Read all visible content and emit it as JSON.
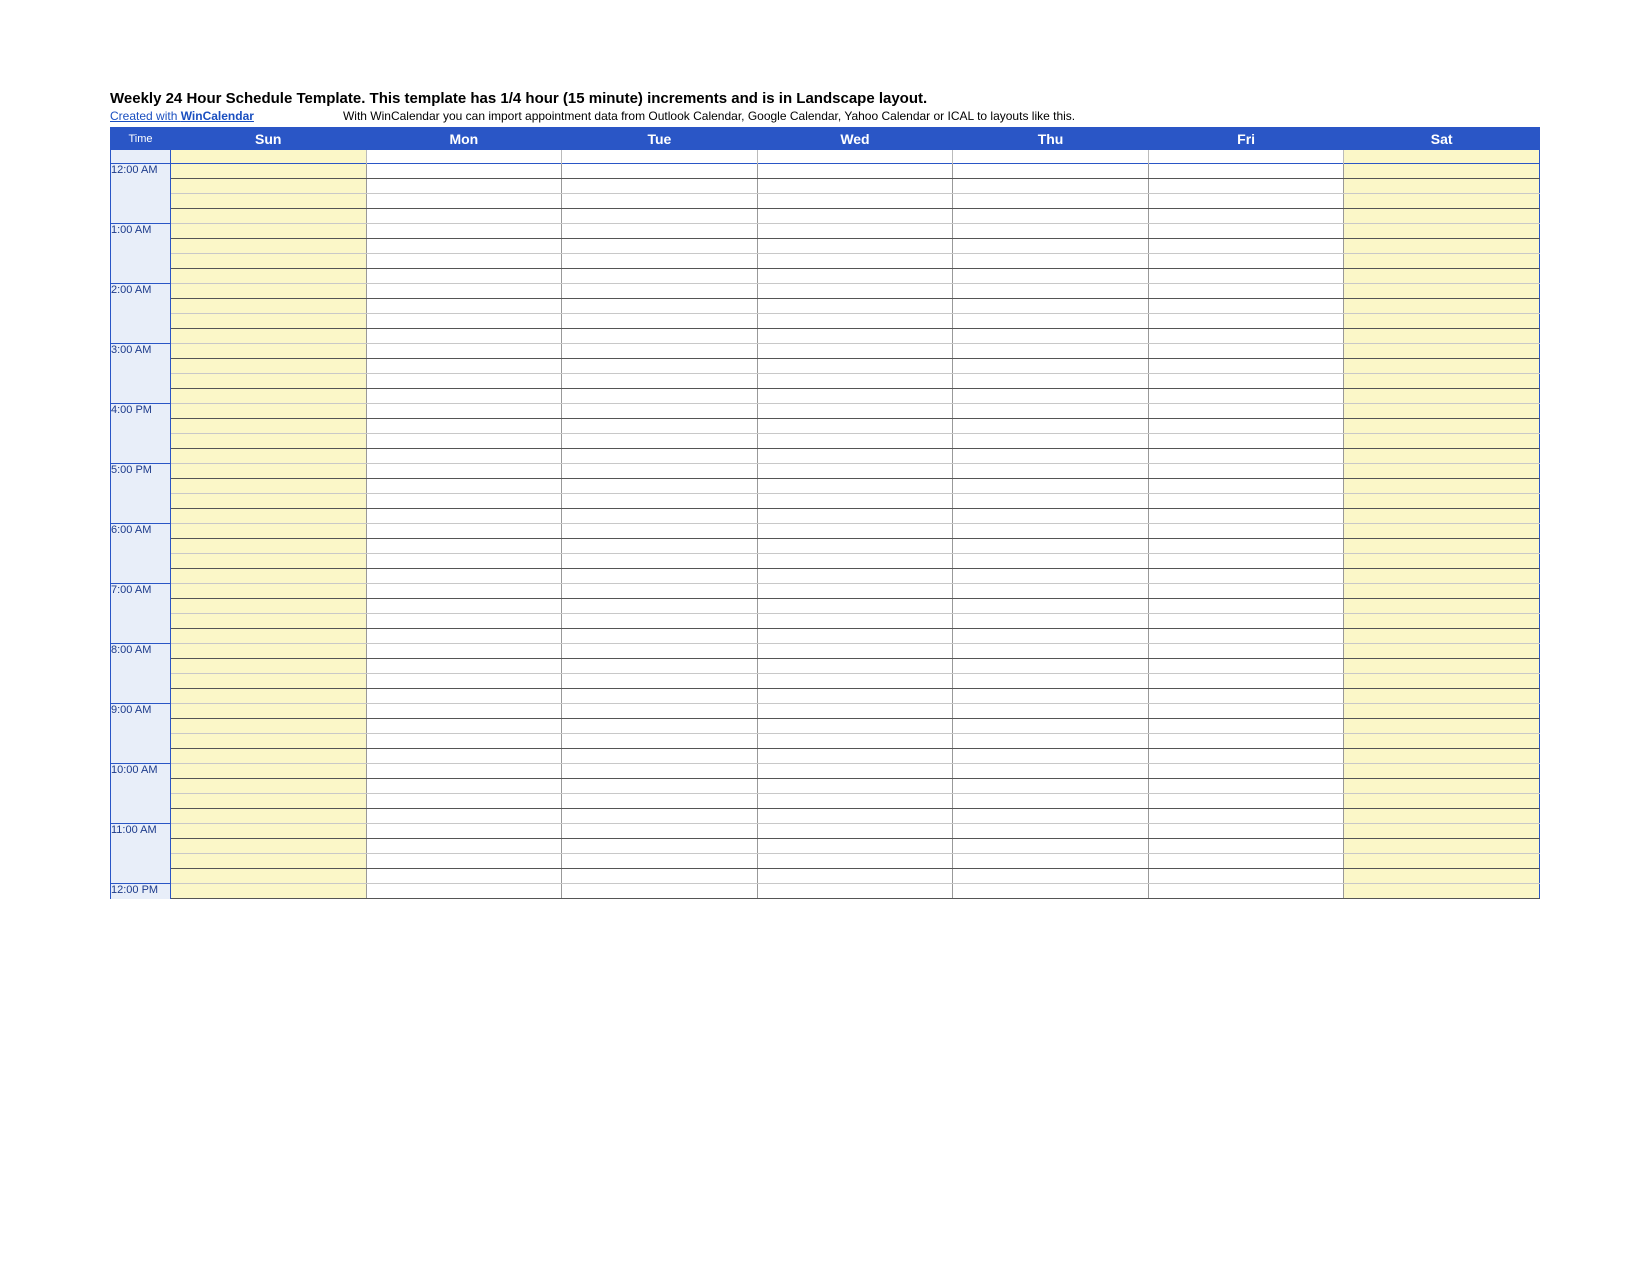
{
  "header": {
    "title": "Weekly 24 Hour Schedule Template.  This template has 1/4 hour (15 minute) increments and is in Landscape layout.",
    "created_with_text": "Created with ",
    "created_with_link": "WinCalendar",
    "import_note": "With WinCalendar you can import appointment data from Outlook Calendar, Google Calendar, Yahoo Calendar or ICAL to layouts like this."
  },
  "columns": {
    "time": "Time",
    "days": [
      "Sun",
      "Mon",
      "Tue",
      "Wed",
      "Thu",
      "Fri",
      "Sat"
    ]
  },
  "hours": [
    "12:00 AM",
    "1:00 AM",
    "2:00 AM",
    "3:00 AM",
    "4:00 PM",
    "5:00 PM",
    "6:00 AM",
    "7:00 AM",
    "8:00 AM",
    "9:00 AM",
    "10:00 AM",
    "11:00 AM",
    "12:00 PM"
  ],
  "quarters_per_hour": 4
}
